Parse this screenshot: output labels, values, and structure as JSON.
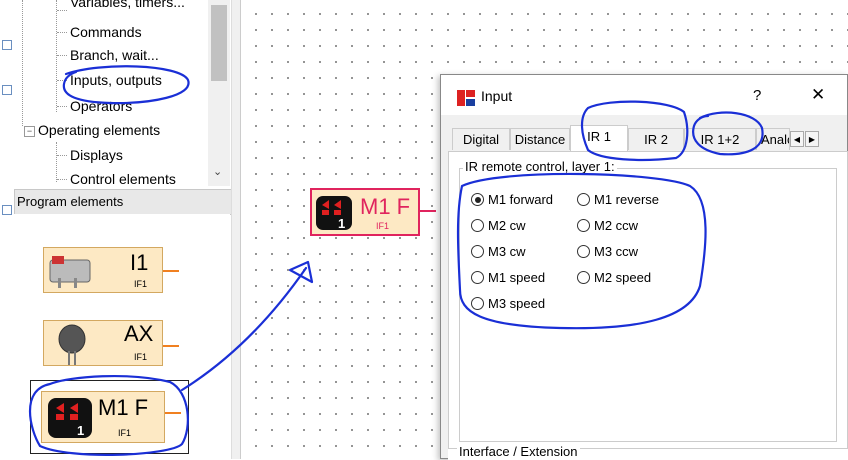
{
  "tree": {
    "items": [
      {
        "label": "Variables, timers..."
      },
      {
        "label": "Commands"
      },
      {
        "label": "Branch, wait..."
      },
      {
        "label": "Inputs, outputs"
      },
      {
        "label": "Operators"
      },
      {
        "label": "Operating elements"
      },
      {
        "label": "Displays"
      },
      {
        "label": "Control elements"
      }
    ]
  },
  "program_elements": {
    "header": "Program elements",
    "blocks": [
      {
        "title": "I1",
        "sub": "IF1",
        "icon": "switch-sensor-icon"
      },
      {
        "title": "AX",
        "sub": "IF1",
        "icon": "analog-sensor-icon"
      },
      {
        "title": "M1 F",
        "sub": "IF1",
        "icon": "motor-icon"
      }
    ]
  },
  "canvas": {
    "block": {
      "title": "M1 F",
      "sub": "IF1",
      "icon": "motor-icon",
      "badge": "1"
    }
  },
  "dialog": {
    "title": "Input",
    "help": "?",
    "close": "✕",
    "tabs": [
      "Digital",
      "Distance",
      "IR 1",
      "IR 2",
      "IR 1+2",
      "Analc"
    ],
    "active_tab": "IR 1",
    "group_title": "IR remote control, layer 1:",
    "options_left": [
      "M1 forward",
      "M2 cw",
      "M3 cw",
      "M1 speed",
      "M3 speed"
    ],
    "options_right": [
      "M1 reverse",
      "M2 ccw",
      "M3 ccw",
      "M2 speed"
    ],
    "selected": "M1 forward",
    "bottom_group": "Interface / Extension",
    "scroll_left": "◀",
    "scroll_right": "▶"
  },
  "colors": {
    "annotation_blue": "#1a2fd6",
    "block_fill": "#fde9c4",
    "selected_block": "#e0245e"
  }
}
